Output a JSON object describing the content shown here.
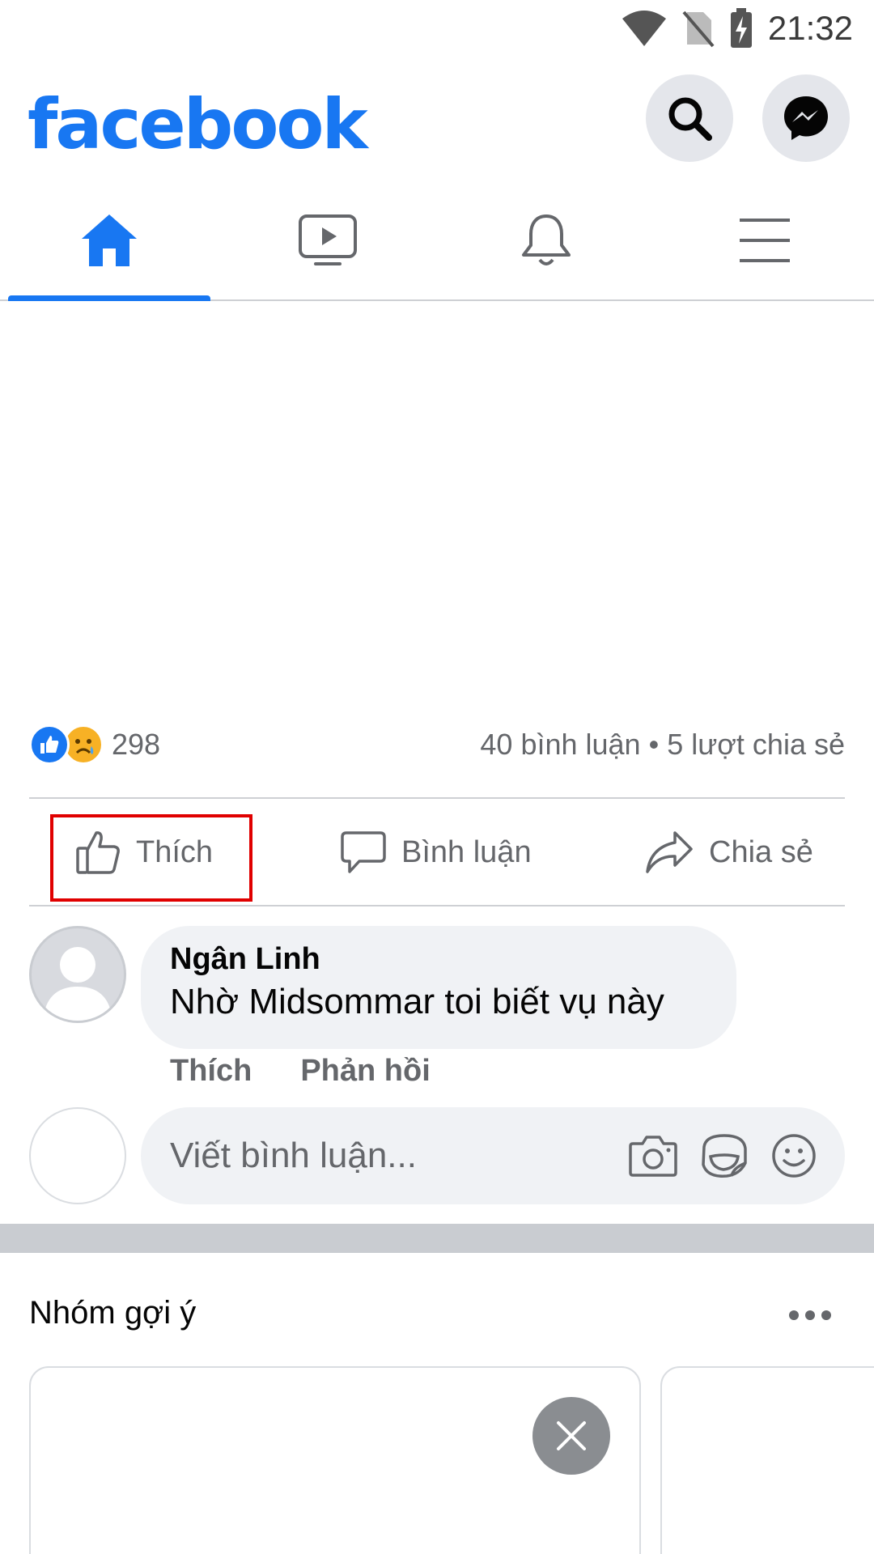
{
  "status_bar": {
    "time": "21:32"
  },
  "header": {
    "logo": "facebook"
  },
  "icons": {
    "search": "search-icon",
    "messenger": "messenger-icon",
    "home": "home-icon",
    "video": "video-icon",
    "notifications": "bell-icon",
    "menu": "menu-icon",
    "like": "thumbs-up-icon",
    "comment": "comment-bubble-icon",
    "share": "share-arrow-icon",
    "camera": "camera-icon",
    "sticker": "sticker-icon",
    "emoji": "emoji-icon",
    "more": "more-dots-icon",
    "close": "close-icon"
  },
  "colors": {
    "brand": "#1877f2",
    "highlight": "#e00000",
    "muted": "#65676b"
  },
  "tabs": [
    {
      "name": "home",
      "active": true
    },
    {
      "name": "video",
      "active": false
    },
    {
      "name": "notifications",
      "active": false
    },
    {
      "name": "menu",
      "active": false
    }
  ],
  "post": {
    "reaction_count": "298",
    "comments_shares": "40 bình luận • 5 lượt chia sẻ",
    "actions": {
      "like": "Thích",
      "comment": "Bình luận",
      "share": "Chia sẻ"
    },
    "comment": {
      "author": "Ngân Linh",
      "text": "Nhờ Midsommar toi biết vụ này",
      "like": "Thích",
      "reply": "Phản hồi"
    },
    "input_placeholder": "Viết bình luận..."
  },
  "suggested_groups": {
    "title": "Nhóm gợi ý"
  }
}
